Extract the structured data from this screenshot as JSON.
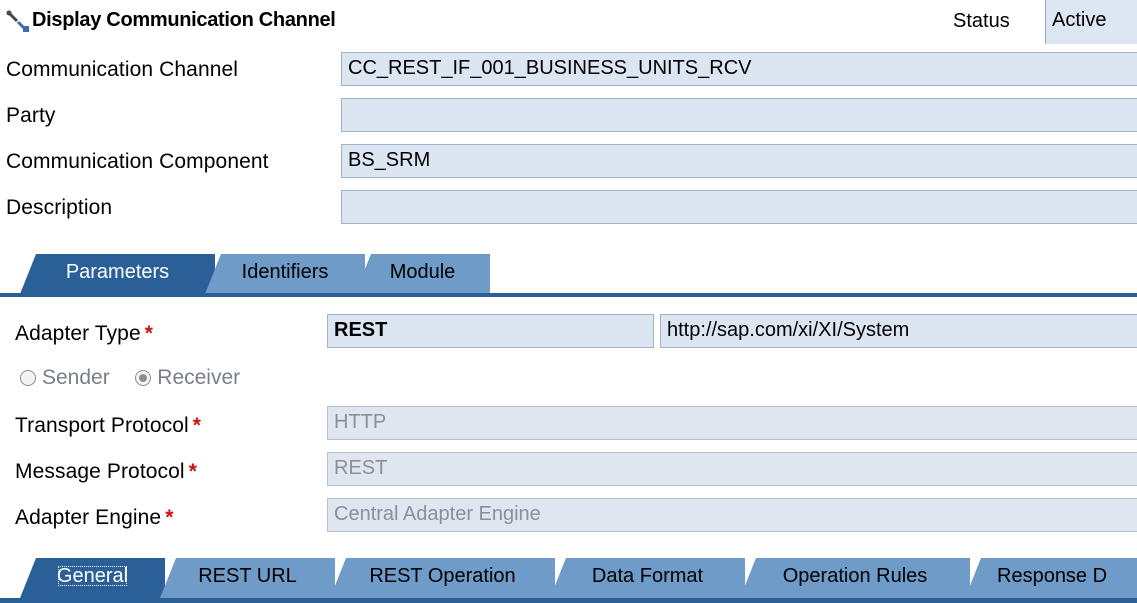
{
  "header": {
    "title": "Display Communication Channel",
    "status_label": "Status",
    "status_value": "Active"
  },
  "form": {
    "communication_channel": {
      "label": "Communication Channel",
      "value": "CC_REST_IF_001_BUSINESS_UNITS_RCV"
    },
    "party": {
      "label": "Party",
      "value": ""
    },
    "communication_component": {
      "label": "Communication Component",
      "value": "BS_SRM"
    },
    "description": {
      "label": "Description",
      "value": ""
    }
  },
  "main_tabs": [
    "Parameters",
    "Identifiers",
    "Module"
  ],
  "parameters": {
    "adapter_type": {
      "label": "Adapter Type",
      "value": "REST",
      "namespace": "http://sap.com/xi/XI/System"
    },
    "direction": {
      "sender": "Sender",
      "receiver": "Receiver",
      "selected": "Receiver"
    },
    "transport_protocol": {
      "label": "Transport Protocol",
      "value": "HTTP"
    },
    "message_protocol": {
      "label": "Message Protocol",
      "value": "REST"
    },
    "adapter_engine": {
      "label": "Adapter Engine",
      "value": "Central Adapter Engine"
    },
    "required_marker": "*"
  },
  "sub_tabs": [
    "General",
    "REST URL",
    "REST Operation",
    "Data Format",
    "Operation Rules",
    "Response D"
  ],
  "icons": {
    "title": "wrench-plug-icon"
  },
  "colors": {
    "tab_active": "#2a6097",
    "tab_inactive": "#6f9bc9",
    "field_bg": "#dce6f3",
    "required": "#d01010"
  }
}
